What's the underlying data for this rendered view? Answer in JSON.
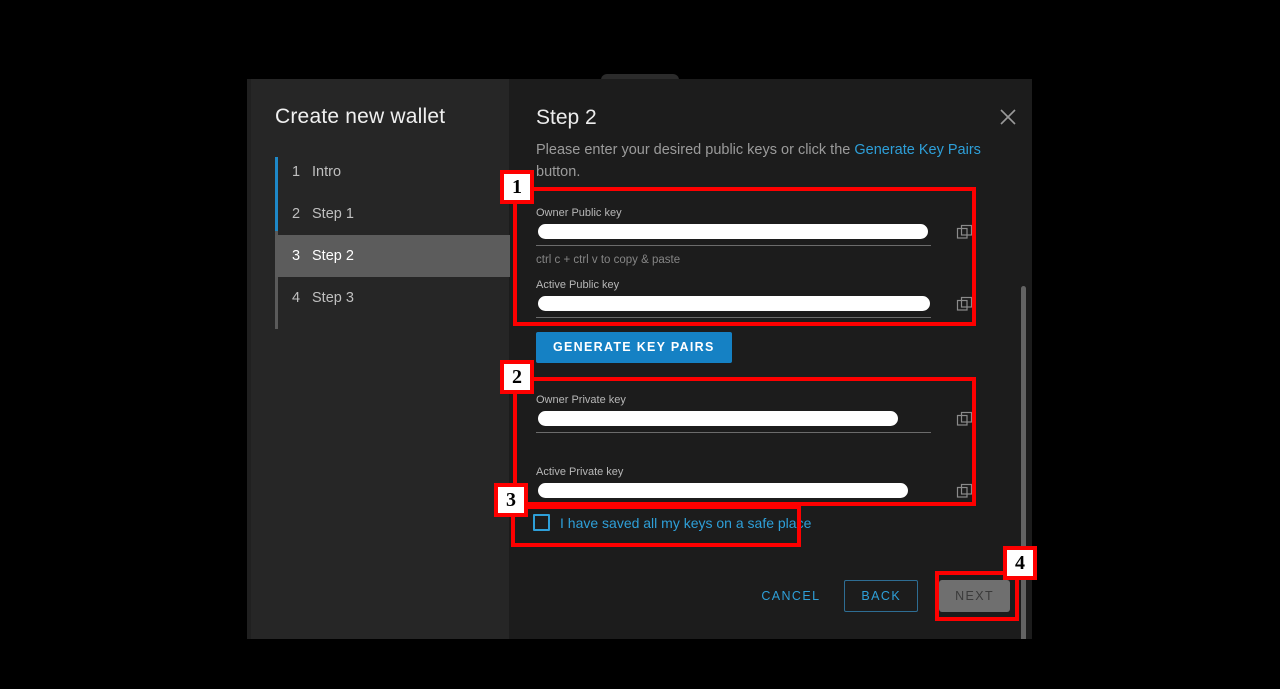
{
  "window": {
    "background_color": "#000000",
    "dialog_bg": "#262626",
    "panel_bg": "#1c1c1c",
    "accent_color": "#2e9fd8",
    "annotation_color": "#fe0000"
  },
  "sidebar": {
    "title": "Create new wallet",
    "items": [
      {
        "num": "1",
        "label": "Intro",
        "active": false
      },
      {
        "num": "2",
        "label": "Step 1",
        "active": false
      },
      {
        "num": "3",
        "label": "Step 2",
        "active": true
      },
      {
        "num": "4",
        "label": "Step 3",
        "active": false
      }
    ]
  },
  "main": {
    "title": "Step 2",
    "close_icon": "close-icon",
    "subtitle_prefix": "Please enter your desired public keys or click the ",
    "subtitle_link": "Generate Key Pairs",
    "subtitle_suffix": " button.",
    "fields": [
      {
        "label": "Owner Public key",
        "value": "",
        "helper": "ctrl c + ctrl v to copy & paste",
        "copy_icon": "copy-icon"
      },
      {
        "label": "Active Public key",
        "value": "",
        "helper": "",
        "copy_icon": "copy-icon"
      },
      {
        "label": "Owner Private key",
        "value": "",
        "helper": "",
        "copy_icon": "copy-icon"
      },
      {
        "label": "Active Private key",
        "value": "",
        "helper": "",
        "copy_icon": "copy-icon"
      }
    ],
    "generate_button": "GENERATE KEY PAIRS",
    "checkbox": {
      "label": "I have saved all my keys on a safe place",
      "checked": false
    },
    "footer": {
      "cancel": "CANCEL",
      "back": "BACK",
      "next": "NEXT",
      "next_disabled": true
    }
  },
  "annotations": [
    {
      "badge": "1",
      "target": "public-keys-group"
    },
    {
      "badge": "2",
      "target": "private-keys-group"
    },
    {
      "badge": "3",
      "target": "saved-keys-checkbox"
    },
    {
      "badge": "4",
      "target": "next-button"
    }
  ]
}
